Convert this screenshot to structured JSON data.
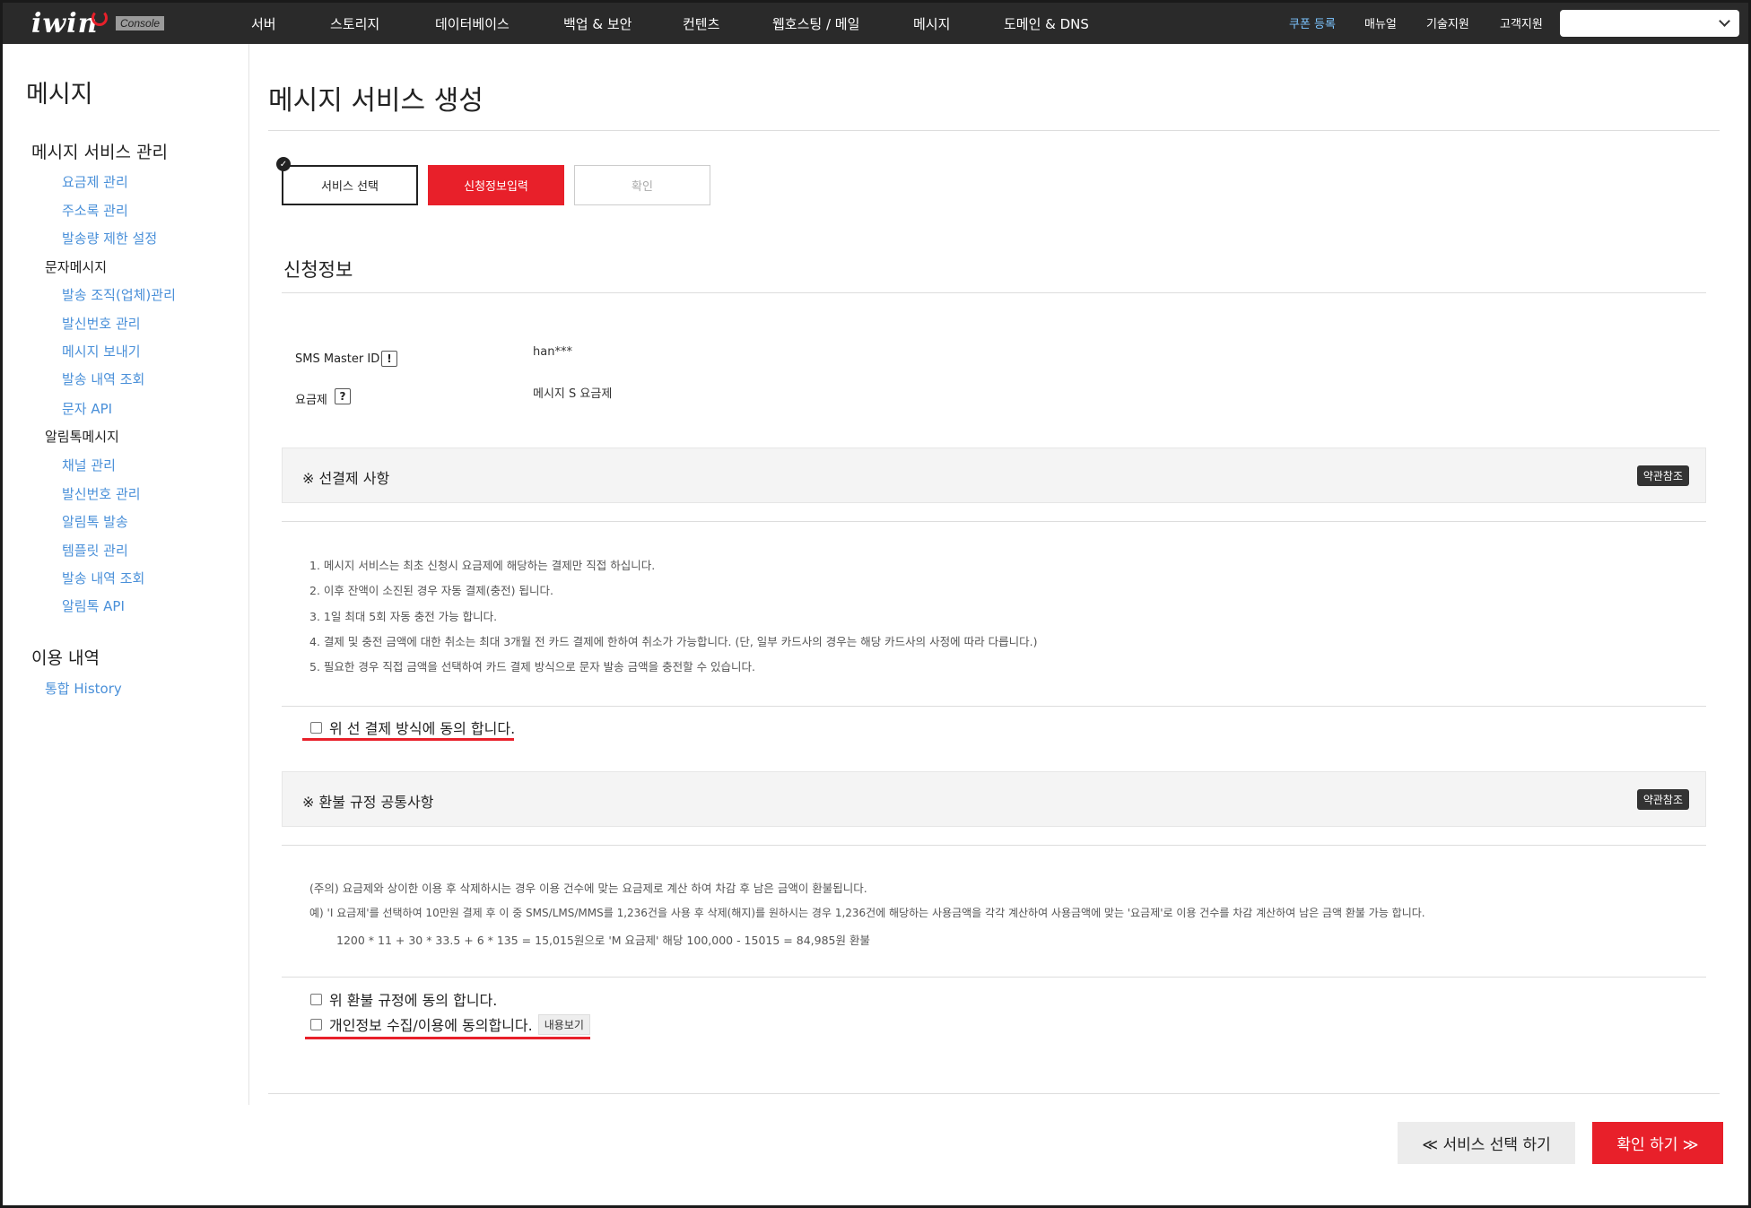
{
  "topbar": {
    "logo": "iwin",
    "badge": "Console",
    "nav": [
      "서버",
      "스토리지",
      "데이터베이스",
      "백업 & 보안",
      "컨텐츠",
      "웹호스팅 / 메일",
      "메시지",
      "도메인 & DNS"
    ],
    "util": [
      "쿠폰 등록",
      "매뉴얼",
      "기술지원",
      "고객지원"
    ],
    "select_value": ""
  },
  "sidebar": {
    "title": "메시지",
    "group1": "메시지 서비스 관리",
    "group1_links": [
      "요금제 관리",
      "주소록 관리",
      "발송량 제한 설정"
    ],
    "sub1": "문자메시지",
    "sub1_links": [
      "발송 조직(업체)관리",
      "발신번호 관리",
      "메시지 보내기",
      "발송 내역 조회",
      "문자 API"
    ],
    "sub2": "알림톡메시지",
    "sub2_links": [
      "채널 관리",
      "발신번호 관리",
      "알림톡 발송",
      "템플릿 관리",
      "발송 내역 조회",
      "알림톡 API"
    ],
    "group2": "이용 내역",
    "group2_links": [
      "통합 History"
    ]
  },
  "main": {
    "page_title": "메시지 서비스 생성",
    "steps": [
      "서비스 선택",
      "신청정보입력",
      "확인"
    ],
    "section_title": "신청정보",
    "fields": [
      {
        "label": "SMS Master ID",
        "icon": "!",
        "value": "han***"
      },
      {
        "label": "요금제",
        "icon": "?",
        "value": "메시지 S 요금제"
      }
    ],
    "prepay": {
      "title": "※ 선결제 사항",
      "terms_label": "약관참조",
      "notes": [
        "1. 메시지 서비스는 최초 신청시 요금제에 해당하는 결제만 직접 하십니다.",
        "2. 이후 잔액이 소진된 경우 자동 결제(충전) 됩니다.",
        "3. 1일 최대 5회 자동 충전 가능 합니다.",
        "4. 결제 및 충전 금액에 대한 취소는 최대 3개월 전 카드 결제에 한하여 취소가 가능합니다. (단, 일부 카드사의 경우는 해당 카드사의 사정에 따라 다릅니다.)",
        "5. 필요한 경우 직접 금액을 선택하여 카드 결제 방식으로 문자 발송 금액을 충전할 수 있습니다."
      ],
      "agree": "위 선 결제 방식에 동의 합니다."
    },
    "refund": {
      "title": "※ 환불 규정 공통사항",
      "terms_label": "약관참조",
      "notes": [
        "(주의) 요금제와 상이한 이용 후 삭제하시는 경우 이용 건수에 맞는 요금제로 계산 하여 차감 후 남은 금액이 환불됩니다.",
        "예) 'I 요금제'를 선택하여 10만원 결제 후 이 중 SMS/LMS/MMS를 1,236건을 사용 후 삭제(해지)를 원하시는 경우 1,236건에 해당하는 사용금액을 각각 계산하여 사용금액에 맞는 '요금제'로 이용 건수를 차감 계산하여 남은 금액 환불 가능 합니다.",
        "1200 * 11 + 30 * 33.5 + 6 * 135 = 15,015원으로 'M 요금제' 해당 100,000 - 15015 = 84,985원 환불"
      ],
      "agree": "위 환불 규정에 동의 합니다.",
      "privacy_agree": "개인정보 수집/이용에 동의합니다.",
      "view_label": "내용보기"
    },
    "back_button": "≪ 서비스 선택 하기",
    "confirm_button": "확인 하기 ≫"
  },
  "colors": {
    "accent": "#e8202a",
    "link": "#4a90d9",
    "topbar": "#2a2a2a"
  }
}
